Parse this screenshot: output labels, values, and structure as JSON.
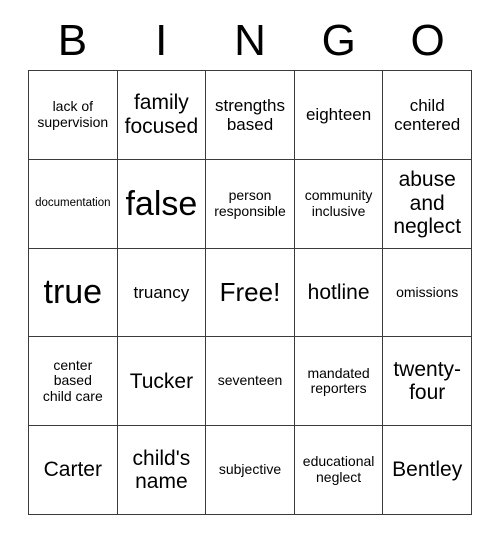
{
  "card": {
    "title": "BINGO",
    "header_letters": [
      "B",
      "I",
      "N",
      "G",
      "O"
    ],
    "rows": [
      [
        {
          "text": "lack of\nsupervision",
          "size": "sm"
        },
        {
          "text": "family\nfocused",
          "size": "lg"
        },
        {
          "text": "strengths\nbased",
          "size": "md"
        },
        {
          "text": "eighteen",
          "size": "md"
        },
        {
          "text": "child\ncentered",
          "size": "md"
        }
      ],
      [
        {
          "text": "documentation",
          "size": "xs"
        },
        {
          "text": "false",
          "size": "xxl"
        },
        {
          "text": "person\nresponsible",
          "size": "sm"
        },
        {
          "text": "community\ninclusive",
          "size": "sm"
        },
        {
          "text": "abuse\nand\nneglect",
          "size": "lg"
        }
      ],
      [
        {
          "text": "true",
          "size": "xxl"
        },
        {
          "text": "truancy",
          "size": "md"
        },
        {
          "text": "Free!",
          "size": "xl"
        },
        {
          "text": "hotline",
          "size": "lg"
        },
        {
          "text": "omissions",
          "size": "sm"
        }
      ],
      [
        {
          "text": "center\nbased\nchild care",
          "size": "sm"
        },
        {
          "text": "Tucker",
          "size": "lg"
        },
        {
          "text": "seventeen",
          "size": "sm"
        },
        {
          "text": "mandated\nreporters",
          "size": "sm"
        },
        {
          "text": "twenty-\nfour",
          "size": "lg"
        }
      ],
      [
        {
          "text": "Carter",
          "size": "lg"
        },
        {
          "text": "child's\nname",
          "size": "lg"
        },
        {
          "text": "subjective",
          "size": "sm"
        },
        {
          "text": "educational\nneglect",
          "size": "sm"
        },
        {
          "text": "Bentley",
          "size": "lg"
        }
      ]
    ],
    "colors": {
      "border": "#3b3b3b",
      "text": "#000000",
      "background": "#ffffff"
    }
  }
}
